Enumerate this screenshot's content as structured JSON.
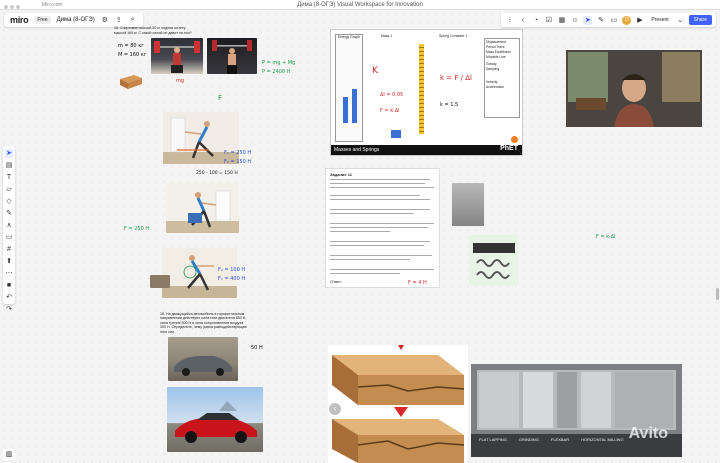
{
  "browser": {
    "window_title": "Дима (8-ОГЭ) Visual Workspace for Innovation",
    "url_label": "Miro.com"
  },
  "header": {
    "logo": "miro",
    "plan_badge": "Free",
    "board_name": "Дима (8-ОГЭ)"
  },
  "topbar": {
    "present_label": "Present",
    "share_label": "Share",
    "avatar_initial": "D",
    "counter": "1"
  },
  "board": {
    "problem_weightlifter": "16. Спортсмен массой 80 кг подняв штангу массой 160 кг. С какой силой он давит на пол?",
    "problem_car": "16. На движущийся автомобиль в горизонтальном направлении действуют сила тяги двигателя 850 Н, сила трения 500 Н и сила сопротивления воздуха 300 Н. Определите, чему равна равнодействующая этих сил.",
    "hw": {
      "m1": "m = 80 кг",
      "m2": "M = 160 кг",
      "p_formula": "P = mg + Mg",
      "p_value": "P = 2400 Н",
      "f1": "F₁ = 250 Н",
      "f2": "F₂ = 150 Н",
      "f3": "F = 250 Н",
      "f4": "F₂ = 100 Н",
      "result1": "F₁ = 400 Н",
      "result2": "250 - 100 = 150 Н",
      "mg": "mg",
      "fup": "F",
      "ans_car": "50 Н",
      "k_label": "K",
      "dl": "Δl = 0,05",
      "fk": "F = k·Δl",
      "k_formula": "k = F / Δl",
      "kx": "k = 1,5",
      "f_spring": "F = 4 Н",
      "sig1": "F = k·Δl"
    },
    "worksheet": {
      "title": "Задание 11",
      "answer_label": "Ответ:"
    },
    "phet": {
      "footer_title": "Masses and Springs",
      "logo": "PhET",
      "panel_labels": [
        "Displacement",
        "Period Trace",
        "Mass Equilibrium",
        "Movable Line"
      ],
      "energy_label": "Energy Graph",
      "gravity_label": "Gravity",
      "damping_label": "Damping",
      "spring1": "Spring Constant 1",
      "mass_label": "Mass 1",
      "velocity_label": "Velocity",
      "accel_label": "Acceleration"
    },
    "roughness_labels": [
      "FLAT LAPPING",
      "GRINDING",
      "FLEXBAR",
      "HORIZONTAL MILLING"
    ],
    "watermark": "Avito"
  },
  "colors": {
    "accent": "#4262ff",
    "ink_green": "#1a9a4a",
    "ink_red": "#d02a2a",
    "ink_blue": "#2c4fd6"
  }
}
